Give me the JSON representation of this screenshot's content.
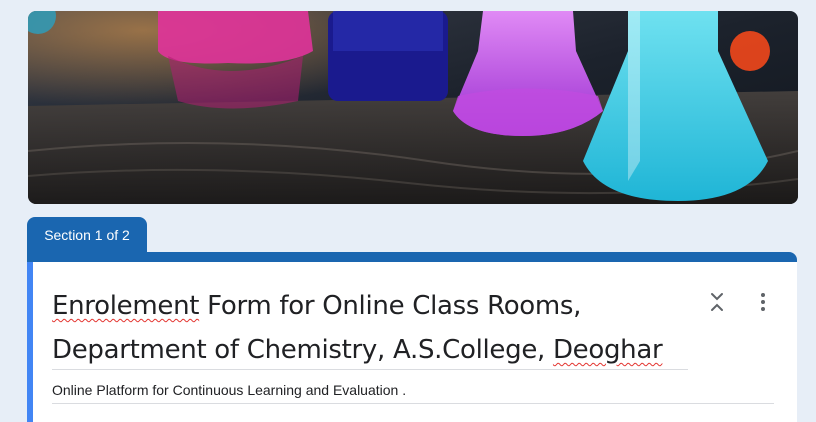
{
  "banner": {
    "icon": "chemistry-flasks-banner"
  },
  "section": {
    "label": "Section 1 of 2"
  },
  "form": {
    "title_parts": [
      "Enrolement",
      " Form for Online Class Rooms, Department of Chemistry, A.S.College, ",
      "Deoghar"
    ],
    "description": "Online Platform for Continuous Learning and Evaluation ."
  },
  "actions": {
    "collapse_icon": "collapse-icon",
    "more_icon": "more-vert-icon"
  },
  "colors": {
    "accent": "#1a66b0",
    "card_border": "#4285f4",
    "background": "#e7eef7"
  }
}
